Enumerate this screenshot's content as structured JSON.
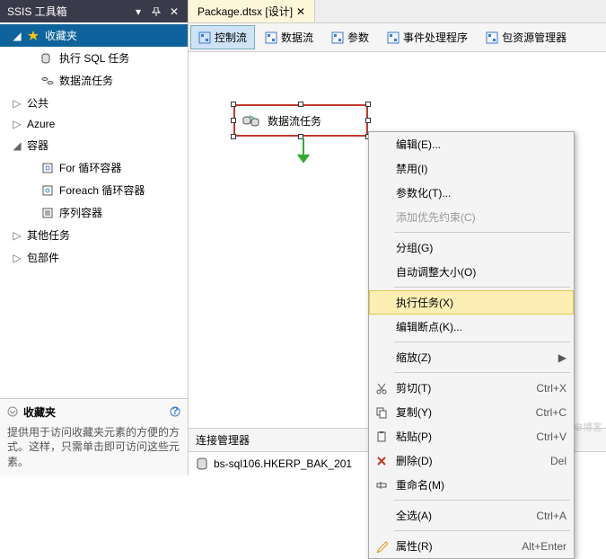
{
  "toolbox": {
    "title": "SSIS 工具箱",
    "favorites_header": "收藏夹",
    "items": [
      {
        "label": "收藏夹",
        "depth": 0,
        "expandable": true,
        "expanded": true,
        "icon": "star",
        "selected": true
      },
      {
        "label": "执行 SQL 任务",
        "depth": 1,
        "expandable": false,
        "icon": "sql"
      },
      {
        "label": "数据流任务",
        "depth": 1,
        "expandable": false,
        "icon": "dataflow"
      },
      {
        "label": "公共",
        "depth": 0,
        "expandable": true,
        "expanded": false
      },
      {
        "label": "Azure",
        "depth": 0,
        "expandable": true,
        "expanded": false
      },
      {
        "label": "容器",
        "depth": 0,
        "expandable": true,
        "expanded": true
      },
      {
        "label": "For 循环容器",
        "depth": 1,
        "expandable": false,
        "icon": "loop"
      },
      {
        "label": "Foreach 循环容器",
        "depth": 1,
        "expandable": false,
        "icon": "loop"
      },
      {
        "label": "序列容器",
        "depth": 1,
        "expandable": false,
        "icon": "seq"
      },
      {
        "label": "其他任务",
        "depth": 0,
        "expandable": true,
        "expanded": false
      },
      {
        "label": "包部件",
        "depth": 0,
        "expandable": true,
        "expanded": false
      }
    ],
    "fav_desc": "提供用于访问收藏夹元素的方便的方式。这样，只需单击即可访问这些元素。"
  },
  "editor": {
    "tab_title": "Package.dtsx [设计]",
    "toolbar": [
      {
        "label": "控制流",
        "icon": "control",
        "active": true
      },
      {
        "label": "数据流",
        "icon": "data"
      },
      {
        "label": "参数",
        "icon": "param"
      },
      {
        "label": "事件处理程序",
        "icon": "event"
      },
      {
        "label": "包资源管理器",
        "icon": "explorer"
      }
    ],
    "task_label": "数据流任务",
    "conn_header": "连接管理器",
    "conn_item": "bs-sql106.HKERP_BAK_201"
  },
  "context_menu": [
    {
      "label": "编辑(E)...",
      "type": "item"
    },
    {
      "label": "禁用(I)",
      "type": "item"
    },
    {
      "label": "参数化(T)...",
      "type": "item"
    },
    {
      "label": "添加优先约束(C)",
      "type": "item",
      "disabled": true
    },
    {
      "type": "sep"
    },
    {
      "label": "分组(G)",
      "type": "item"
    },
    {
      "label": "自动调整大小(O)",
      "type": "item"
    },
    {
      "type": "sep"
    },
    {
      "label": "执行任务(X)",
      "type": "item",
      "highlighted": true
    },
    {
      "label": "编辑断点(K)...",
      "type": "item"
    },
    {
      "type": "sep"
    },
    {
      "label": "缩放(Z)",
      "type": "submenu"
    },
    {
      "type": "sep"
    },
    {
      "label": "剪切(T)",
      "type": "item",
      "icon": "cut",
      "shortcut": "Ctrl+X"
    },
    {
      "label": "复制(Y)",
      "type": "item",
      "icon": "copy",
      "shortcut": "Ctrl+C"
    },
    {
      "label": "粘贴(P)",
      "type": "item",
      "icon": "paste",
      "shortcut": "Ctrl+V"
    },
    {
      "label": "删除(D)",
      "type": "item",
      "icon": "delete",
      "shortcut": "Del"
    },
    {
      "label": "重命名(M)",
      "type": "item",
      "icon": "rename"
    },
    {
      "type": "sep"
    },
    {
      "label": "全选(A)",
      "type": "item",
      "shortcut": "Ctrl+A"
    },
    {
      "type": "sep"
    },
    {
      "label": "属性(R)",
      "type": "item",
      "icon": "props",
      "shortcut": "Alt+Enter"
    }
  ],
  "watermark": "@ITPUB博客"
}
